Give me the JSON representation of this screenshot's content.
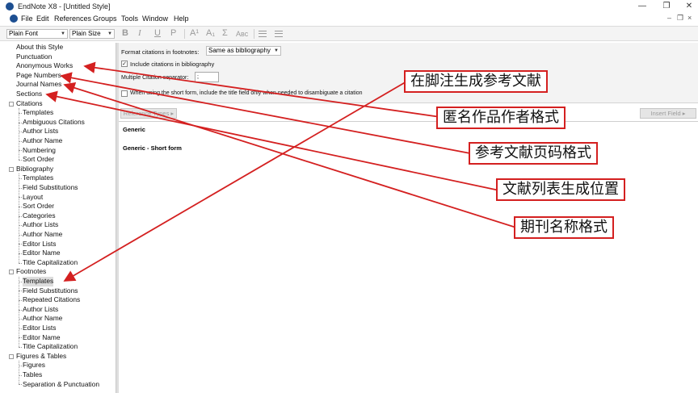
{
  "window": {
    "title": "EndNote X8 - [Untitled Style]"
  },
  "menu": [
    "File",
    "Edit",
    "References",
    "Groups",
    "Tools",
    "Window",
    "Help"
  ],
  "toolbar": {
    "font": "Plain Font",
    "size": "Plain Size",
    "format_buttons": [
      "B",
      "I",
      "U",
      "P",
      "A¹",
      "A₁",
      "Σ",
      "Aʙᴄ"
    ]
  },
  "sidebar": {
    "top_items": [
      "About this Style",
      "Punctuation",
      "Anonymous Works",
      "Page Numbers",
      "Journal Names",
      "Sections"
    ],
    "groups": [
      {
        "label": "Citations",
        "items": [
          "Templates",
          "Ambiguous Citations",
          "Author Lists",
          "Author Name",
          "Numbering",
          "Sort Order"
        ]
      },
      {
        "label": "Bibliography",
        "items": [
          "Templates",
          "Field Substitutions",
          "Layout",
          "Sort Order",
          "Categories",
          "Author Lists",
          "Author Name",
          "Editor Lists",
          "Editor Name",
          "Title Capitalization"
        ]
      },
      {
        "label": "Footnotes",
        "items": [
          "Templates",
          "Field Substitutions",
          "Repeated Citations",
          "Author Lists",
          "Author Name",
          "Editor Lists",
          "Editor Name",
          "Title Capitalization"
        ]
      },
      {
        "label": "Figures & Tables",
        "items": [
          "Figures",
          "Tables",
          "Separation & Punctuation"
        ]
      }
    ],
    "selected": "Footnotes > Templates"
  },
  "options": {
    "format_label": "Format citations in footnotes:",
    "format_value": "Same as bibliography",
    "include_label": "Include citations in bibliography",
    "include_checked": true,
    "separator_label": "Multiple Citation separator:",
    "separator_value": ";",
    "short_form_label": "When using the short form, include the title field only when needed to disambiguate a citation",
    "short_form_checked": false,
    "ref_types_button": "Reference Types",
    "insert_field_button": "Insert Field"
  },
  "editor": {
    "line1": "Generic",
    "line2": "Generic - Short form"
  },
  "annotations": {
    "a1": "在脚注生成参考文献",
    "a2": "匿名作品作者格式",
    "a3": "参考文献页码格式",
    "a4": "文献列表生成位置",
    "a5": "期刊名称格式",
    "color": "#d42020"
  }
}
